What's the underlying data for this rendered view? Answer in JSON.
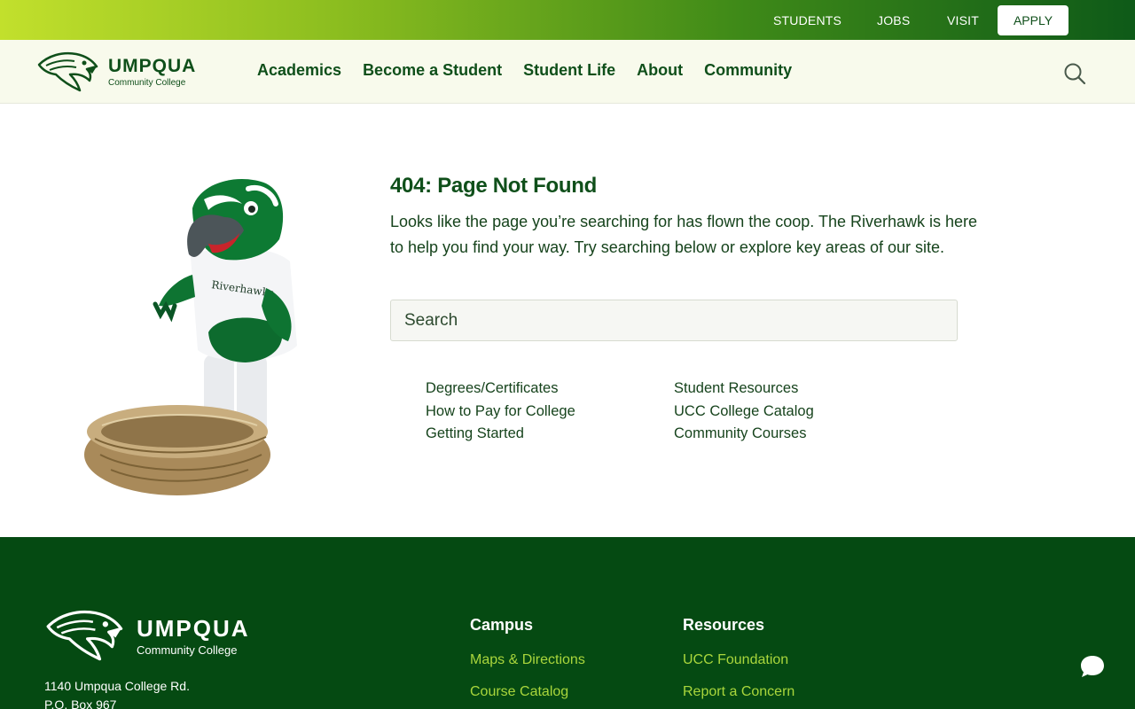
{
  "utility_nav": {
    "items": [
      "STUDENTS",
      "JOBS",
      "VISIT"
    ],
    "apply_label": "APPLY"
  },
  "header": {
    "logo": {
      "name": "UMPQUA",
      "subtitle": "Community College"
    },
    "nav": [
      "Academics",
      "Become a Student",
      "Student Life",
      "About",
      "Community"
    ],
    "search_icon": "search-icon"
  },
  "main": {
    "title": "404: Page Not Found",
    "intro": "Looks like the page you’re searching for has flown the coop. The Riverhawk is here to help you find your way. Try searching below or explore key areas of our site.",
    "search": {
      "placeholder": "Search"
    },
    "links_left": [
      "Degrees/Certificates",
      "How to Pay for College",
      "Getting Started"
    ],
    "links_right": [
      "Student Resources",
      "UCC College Catalog",
      "Community Courses"
    ]
  },
  "footer": {
    "logo": {
      "name": "UMPQUA",
      "subtitle": "Community College"
    },
    "address": [
      "1140 Umpqua College Rd.",
      "P.O. Box 967"
    ],
    "campus": {
      "heading": "Campus",
      "links": [
        "Maps & Directions",
        "Course Catalog"
      ]
    },
    "resources": {
      "heading": "Resources",
      "links": [
        "UCC Foundation",
        "Report a Concern"
      ]
    }
  },
  "colors": {
    "brand_dark_green": "#0f4f1a",
    "footer_green": "#054a12",
    "accent_lime": "#a9d63c",
    "header_bg": "#f8faec"
  },
  "icons": [
    "hawk-logo-icon",
    "search-icon",
    "chat-bubble-icon"
  ]
}
